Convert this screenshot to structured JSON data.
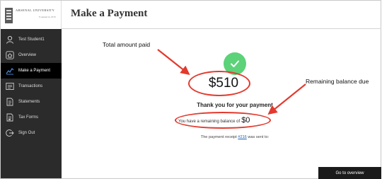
{
  "logo": {
    "title": "ARSENAL UNIVERSITY",
    "subtitle": "Founded in 1870"
  },
  "sidebar": {
    "items": [
      {
        "label": "Test Student1",
        "icon": "user-icon",
        "active": false
      },
      {
        "label": "Overview",
        "icon": "home-icon",
        "active": false
      },
      {
        "label": "Make a Payment",
        "icon": "payment-icon",
        "active": true
      },
      {
        "label": "Transactions",
        "icon": "transactions-icon",
        "active": false
      },
      {
        "label": "Statements",
        "icon": "statements-icon",
        "active": false
      },
      {
        "label": "Tax Forms",
        "icon": "tax-forms-icon",
        "active": false
      },
      {
        "label": "Sign Out",
        "icon": "sign-out-icon",
        "active": false
      }
    ]
  },
  "main": {
    "title": "Make a Payment",
    "amount_paid": "$510",
    "thank_you": "Thank you for your payment",
    "remaining_text": "You have a remaining balance of",
    "remaining_amount": "$0",
    "receipt_prefix": "The payment receipt",
    "receipt_number": "#216",
    "receipt_suffix": "was sent to:",
    "overview_button": "Go to overview"
  },
  "annotations": {
    "total_amount_paid": "Total amount paid",
    "remaining_balance_due": "Remaining balance due"
  },
  "colors": {
    "sidebar_bg": "#2b2b2b",
    "active_bg": "#000000",
    "success_green": "#5cd279",
    "annotation_red": "#e23a2e",
    "link_blue": "#1a5fb4"
  }
}
